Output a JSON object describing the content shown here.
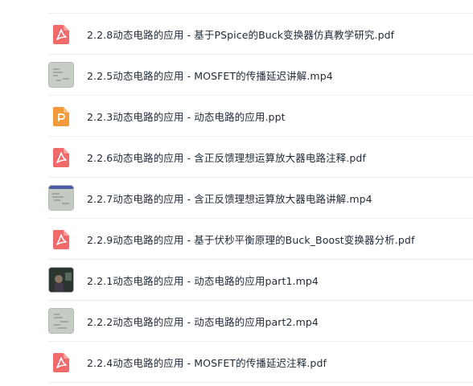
{
  "files": [
    {
      "name": "2.2.8动态电路的应用 - 基于PSpice的Buck变换器仿真教学研究.pdf",
      "type": "pdf",
      "icon": "pdf-file-icon"
    },
    {
      "name": "2.2.5动态电路的应用 - MOSFET的传播延迟讲解.mp4",
      "type": "video",
      "icon": "video-thumbnail"
    },
    {
      "name": "2.2.3动态电路的应用 - 动态电路的应用.ppt",
      "type": "ppt",
      "icon": "ppt-file-icon"
    },
    {
      "name": "2.2.6动态电路的应用 - 含正反馈理想运算放大器电路注释.pdf",
      "type": "pdf",
      "icon": "pdf-file-icon"
    },
    {
      "name": "2.2.7动态电路的应用 - 含正反馈理想运算放大器电路讲解.mp4",
      "type": "video",
      "icon": "video-thumbnail"
    },
    {
      "name": "2.2.9动态电路的应用 - 基于伏秒平衡原理的Buck_Boost变换器分析.pdf",
      "type": "pdf",
      "icon": "pdf-file-icon"
    },
    {
      "name": "2.2.1动态电路的应用 - 动态电路的应用part1.mp4",
      "type": "video-dark",
      "icon": "video-thumbnail"
    },
    {
      "name": "2.2.2动态电路的应用 - 动态电路的应用part2.mp4",
      "type": "video",
      "icon": "video-thumbnail"
    },
    {
      "name": "2.2.4动态电路的应用 - MOSFET的传播延迟注释.pdf",
      "type": "pdf",
      "icon": "pdf-file-icon"
    }
  ],
  "colors": {
    "pdf": "#f16a6a",
    "ppt": "#f59a3c",
    "text": "#1f2937",
    "divider": "#eceef2"
  }
}
